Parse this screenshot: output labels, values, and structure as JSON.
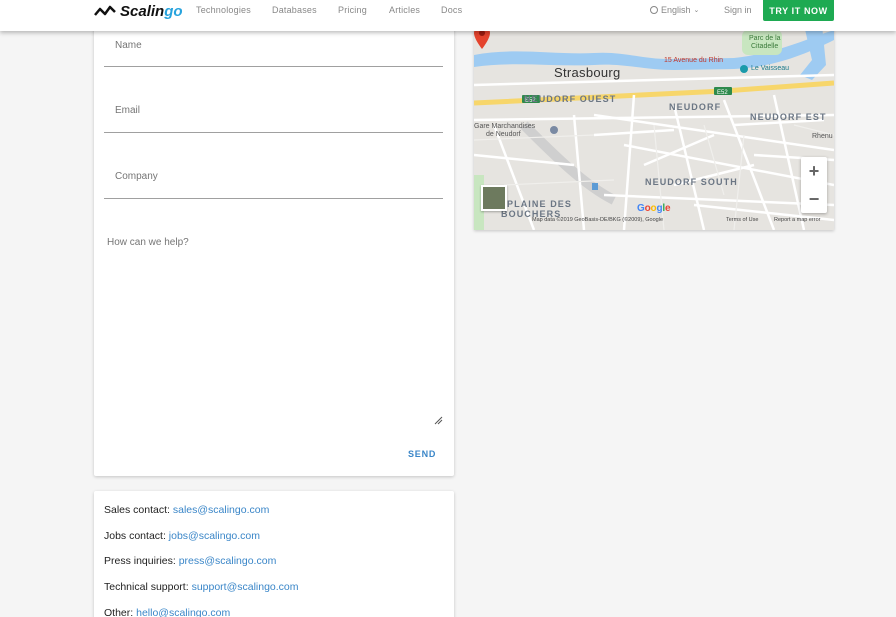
{
  "header": {
    "logo_text_a": "Scalin",
    "logo_text_b": "go",
    "nav": [
      "Technologies",
      "Databases",
      "Pricing",
      "Articles",
      "Docs"
    ],
    "language": "English",
    "signin": "Sign in",
    "cta": "TRY IT NOW"
  },
  "form": {
    "name_placeholder": "Name",
    "email_placeholder": "Email",
    "company_placeholder": "Company",
    "message_placeholder": "How can we help?",
    "send_label": "SEND"
  },
  "contacts": [
    {
      "label": "Sales contact:",
      "email": "sales@scalingo.com"
    },
    {
      "label": "Jobs contact:",
      "email": "jobs@scalingo.com"
    },
    {
      "label": "Press inquiries:",
      "email": "press@scalingo.com"
    },
    {
      "label": "Technical support:",
      "email": "support@scalingo.com"
    },
    {
      "label": "Other:",
      "email": "hello@scalingo.com"
    }
  ],
  "map": {
    "city": "Strasbourg",
    "address": "15 Avenue du Rhin",
    "districts": [
      "NEUDORF OUEST",
      "NEUDORF",
      "NEUDORF EST",
      "NEUDORF SOUTH",
      "PLAINE DES",
      "BOUCHERS"
    ],
    "pois": [
      "Parc de la",
      "Citadelle",
      "Le Vaisseau",
      "Gare Marchandises",
      "de Neudorf",
      "Rhenu"
    ],
    "roads": [
      "E52",
      "E52"
    ],
    "google": "Google",
    "attribution": "Map data ©2019 GeoBasis-DE/BKG (©2009), Google",
    "terms": "Terms of Use",
    "report": "Report a map error",
    "zoom_in": "+",
    "zoom_out": "−"
  }
}
